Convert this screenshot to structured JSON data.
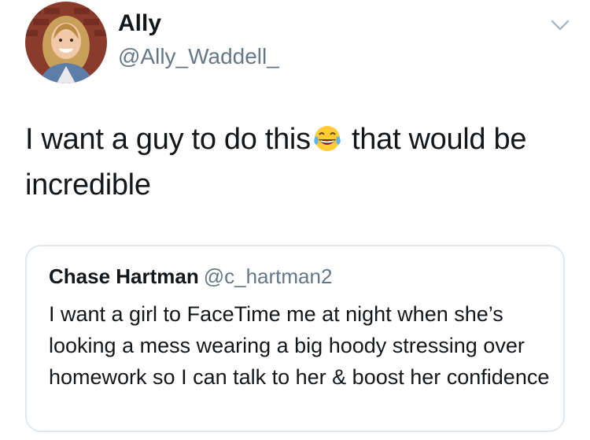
{
  "tweet": {
    "author_name": "Ally",
    "author_handle": "@Ally_Waddell_",
    "text_before_emoji": "I want a guy to do this",
    "emoji": "face-with-tears-of-joy",
    "text_after_emoji": " that would be incredible"
  },
  "quoted_tweet": {
    "author_name": "Chase Hartman",
    "author_handle": "@c_hartman2",
    "text": "I want a girl to FaceTime me at night when she’s looking a mess wearing a big hoody stressing over homework so I can talk to her & boost her confidence"
  },
  "icons": {
    "menu": "chevron-down-icon",
    "avatar": "profile-photo"
  },
  "colors": {
    "text_primary": "#14171a",
    "text_secondary": "#657786",
    "border": "#e1e8ed"
  }
}
